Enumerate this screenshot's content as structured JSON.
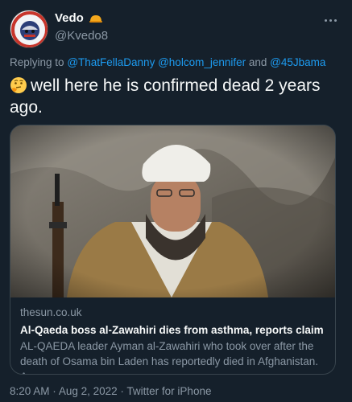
{
  "author": {
    "display_name": "Vedo",
    "handle": "@Kvedo8",
    "badge_color": "#f4a81d",
    "avatar_icon": "politically-incorrect-logo-icon"
  },
  "more_icon": "more-dots-icon",
  "reply_context": {
    "prefix": "Replying to",
    "mention1": "@ThatFellaDanny",
    "mention2": "@holcom_jennifer",
    "conjunction": "and",
    "mention3": "@45Jbama"
  },
  "tweet": {
    "emoji": "thinking-face-icon",
    "text": "well here he is confirmed dead 2 years ago."
  },
  "link_card": {
    "domain": "thesun.co.uk",
    "title": "Al-Qaeda boss al-Zawahiri dies from asthma, reports claim",
    "description": "AL-QAEDA leader Ayman al-Zawahiri who took over after the death of Osama bin Laden has reportedly died in Afghanistan. A..."
  },
  "meta": {
    "time": "8:20 AM",
    "separator1": "·",
    "date": "Aug 2, 2022",
    "separator2": "·",
    "source": "Twitter for iPhone"
  },
  "colors": {
    "background": "#15202b",
    "text_primary": "#f7f9f9",
    "text_secondary": "#8b98a5",
    "link": "#1d9bf0",
    "border": "#38444d"
  }
}
